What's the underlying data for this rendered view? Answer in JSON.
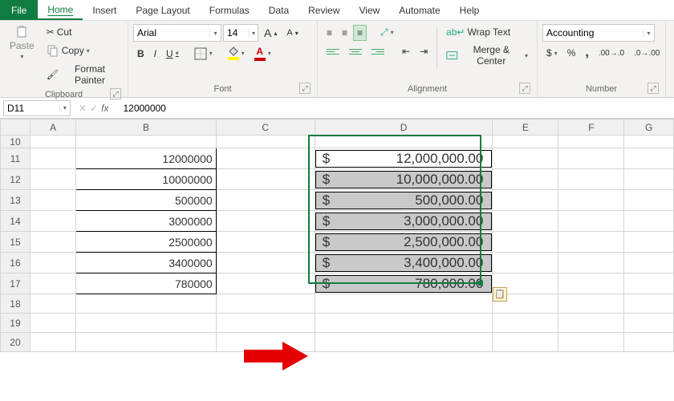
{
  "tabs": {
    "file": "File",
    "home": "Home",
    "insert": "Insert",
    "page_layout": "Page Layout",
    "formulas": "Formulas",
    "data": "Data",
    "review": "Review",
    "view": "View",
    "automate": "Automate",
    "help": "Help"
  },
  "ribbon": {
    "clipboard": {
      "label": "Clipboard",
      "paste": "Paste",
      "cut": "Cut",
      "copy": "Copy",
      "format_painter": "Format Painter"
    },
    "font": {
      "label": "Font",
      "name": "Arial",
      "size": "14",
      "increase_a": "A",
      "decrease_a": "A",
      "bold": "B",
      "italic": "I",
      "underline": "U"
    },
    "alignment": {
      "label": "Alignment",
      "wrap_text": "Wrap Text",
      "merge_center": "Merge & Center"
    },
    "number": {
      "label": "Number",
      "format": "Accounting",
      "currency": "$",
      "percent": "%",
      "comma": ","
    }
  },
  "formula_bar": {
    "name_box": "D11",
    "fx": "fx",
    "value": "12000000"
  },
  "columns": [
    "A",
    "B",
    "C",
    "D",
    "E",
    "F",
    "G"
  ],
  "rows": [
    "10",
    "11",
    "12",
    "13",
    "14",
    "15",
    "16",
    "17",
    "18",
    "19",
    "20"
  ],
  "data_b": [
    "12000000",
    "10000000",
    "500000",
    "3000000",
    "2500000",
    "3400000",
    "780000"
  ],
  "data_d": [
    {
      "sym": "$",
      "val": "12,000,000.00"
    },
    {
      "sym": "$",
      "val": "10,000,000.00"
    },
    {
      "sym": "$",
      "val": "500,000.00"
    },
    {
      "sym": "$",
      "val": "3,000,000.00"
    },
    {
      "sym": "$",
      "val": "2,500,000.00"
    },
    {
      "sym": "$",
      "val": "3,400,000.00"
    },
    {
      "sym": "$",
      "val": "780,000.00"
    }
  ]
}
